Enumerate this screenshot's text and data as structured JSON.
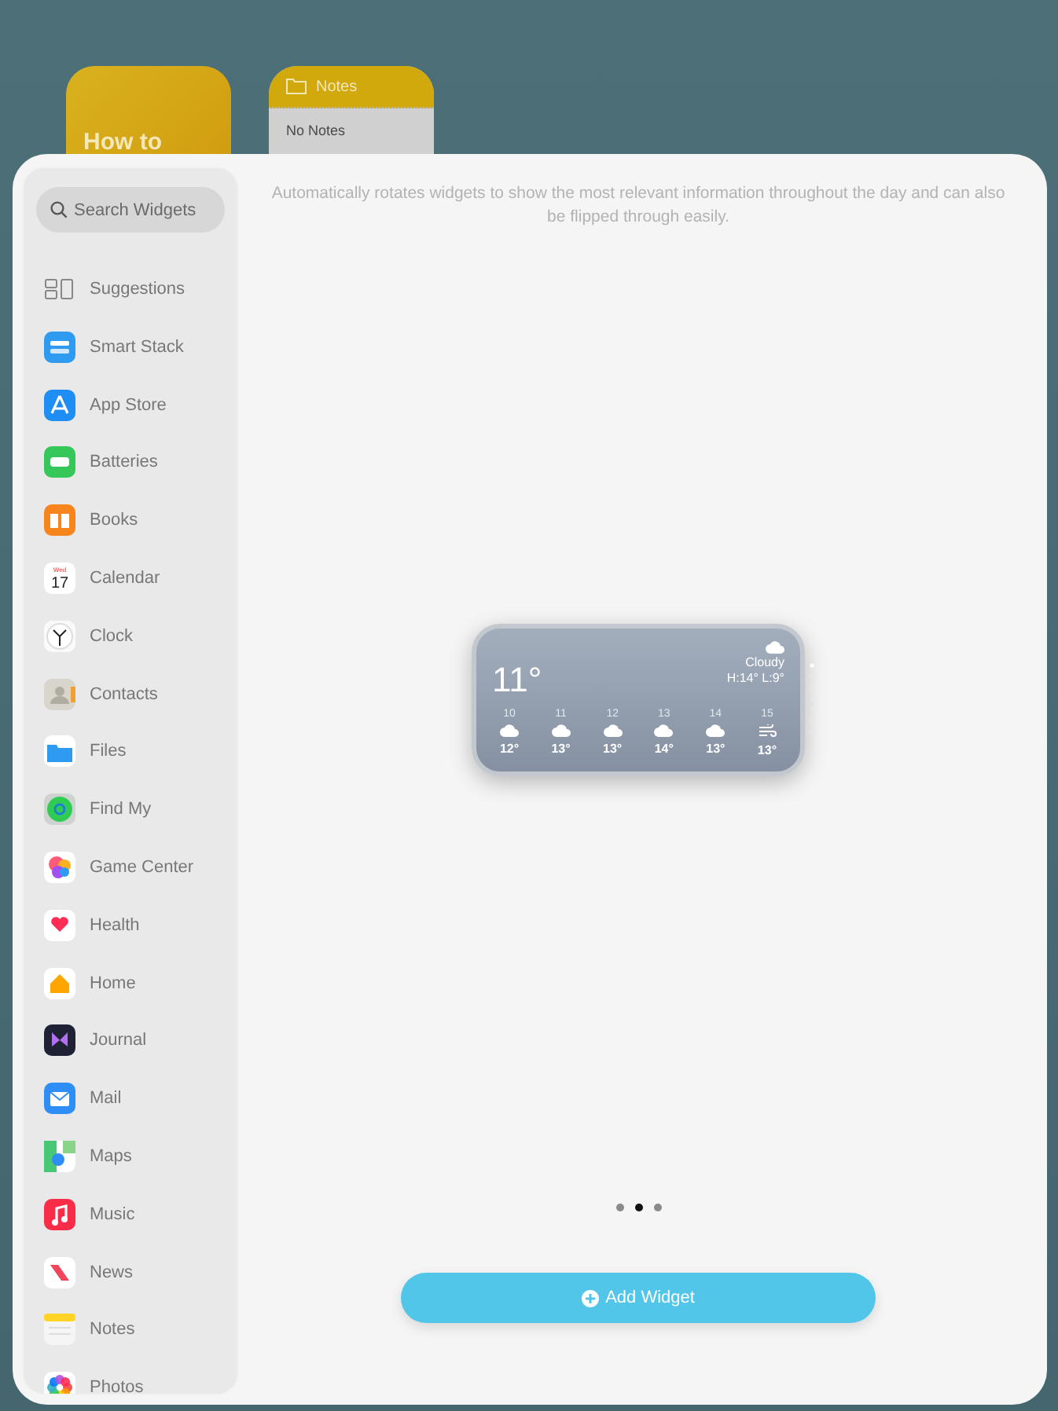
{
  "background_widgets": [
    {
      "kind": "tip",
      "title": "How to"
    },
    {
      "kind": "notes",
      "header": "Notes",
      "body": "No Notes"
    }
  ],
  "sidebar": {
    "search": {
      "placeholder": "Search Widgets"
    },
    "items": [
      {
        "label": "Suggestions"
      },
      {
        "label": "Smart Stack"
      },
      {
        "label": "App Store"
      },
      {
        "label": "Batteries"
      },
      {
        "label": "Books"
      },
      {
        "label": "Calendar",
        "icon_text": "17",
        "icon_caption": "Wed"
      },
      {
        "label": "Clock"
      },
      {
        "label": "Contacts"
      },
      {
        "label": "Files"
      },
      {
        "label": "Find My"
      },
      {
        "label": "Game Center"
      },
      {
        "label": "Health"
      },
      {
        "label": "Home"
      },
      {
        "label": "Journal"
      },
      {
        "label": "Mail"
      },
      {
        "label": "Maps"
      },
      {
        "label": "Music"
      },
      {
        "label": "News"
      },
      {
        "label": "Notes"
      },
      {
        "label": "Photos"
      }
    ]
  },
  "description": "Automatically rotates widgets to show the most relevant information throughout the day and can also be flipped through easily.",
  "weather_widget": {
    "temperature": "11°",
    "condition": "Cloudy",
    "high_low": "H:14° L:9°",
    "hours": [
      {
        "hour": "10",
        "kind": "cloud",
        "temp": "12°"
      },
      {
        "hour": "11",
        "kind": "cloud",
        "temp": "13°"
      },
      {
        "hour": "12",
        "kind": "cloud",
        "temp": "13°"
      },
      {
        "hour": "13",
        "kind": "cloud",
        "temp": "14°"
      },
      {
        "hour": "14",
        "kind": "cloud",
        "temp": "13°"
      },
      {
        "hour": "15",
        "kind": "wind",
        "temp": "13°"
      }
    ]
  },
  "pages": [
    {
      "selected": false
    },
    {
      "selected": true
    },
    {
      "selected": false
    }
  ],
  "add_button": {
    "label": "Add Widget"
  }
}
